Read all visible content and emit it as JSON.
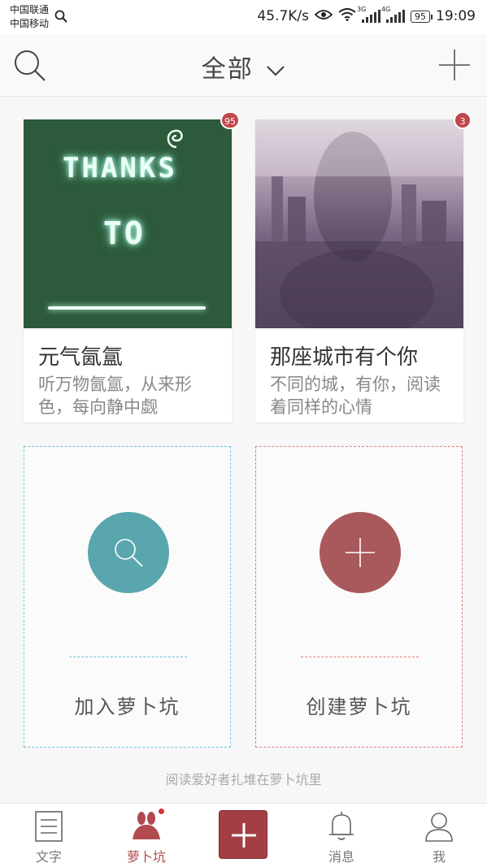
{
  "status_bar": {
    "carrier_1": "中国联通",
    "carrier_2": "中国移动",
    "net_speed": "45.7K/s",
    "signal_1": "3G",
    "signal_2": "4G",
    "battery": "95",
    "time": "19:09"
  },
  "header": {
    "title": "全部"
  },
  "cards": [
    {
      "name": "元气氤氲",
      "desc": "听万物氤氲，从来形色，每向静中觑",
      "badge": "95",
      "cover_text_1": "THANKS",
      "cover_text_2": "TO"
    },
    {
      "name": "那座城市有个你",
      "desc": "不同的城，有你，阅读着同样的心情",
      "badge": "3"
    }
  ],
  "actions": {
    "join_label": "加入萝卜坑",
    "create_label": "创建萝卜坑"
  },
  "footer_note": "阅读爱好者扎堆在萝卜坑里",
  "tabbar": {
    "tab_text": "文字",
    "tab_pit": "萝卜坑",
    "tab_msg": "消息",
    "tab_me": "我"
  },
  "colors": {
    "accent_red": "#a33f44",
    "join_teal": "#5aa6ae",
    "create_red": "#a9595c",
    "badge_red": "#c0464c"
  }
}
